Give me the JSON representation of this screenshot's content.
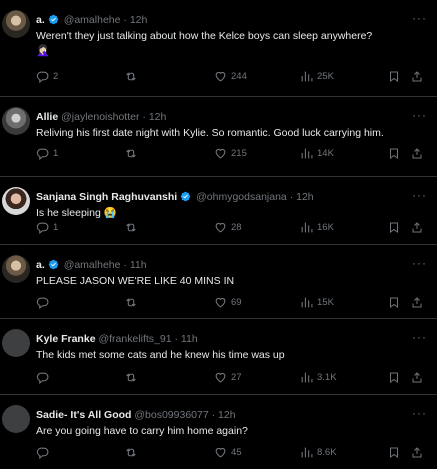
{
  "tweets": [
    {
      "name": "a.",
      "verified": true,
      "handle": "@amalhehe",
      "time": "12h",
      "text": "Weren't they just talking about how the Kelce boys can sleep anywhere?",
      "emoji": "🤦🏻‍♀️",
      "replies": "2",
      "retweets": "",
      "likes": "244",
      "views": "25K"
    },
    {
      "name": "Allie",
      "verified": false,
      "handle": "@jaylenoishotter",
      "time": "12h",
      "text": "Reliving his first date night with Kylie. So romantic. Good luck carrying him.",
      "replies": "1",
      "retweets": "",
      "likes": "215",
      "views": "14K"
    },
    {
      "name": "Sanjana Singh Raghuvanshi",
      "verified": true,
      "handle": "@ohmygodsanjana",
      "time": "12h",
      "text": "Is he sleeping 😭",
      "replies": "1",
      "retweets": "",
      "likes": "28",
      "views": "16K"
    },
    {
      "name": "a.",
      "verified": true,
      "handle": "@amalhehe",
      "time": "11h",
      "text": "PLEASE JASON WE'RE LIKE 40 MINS IN",
      "replies": "",
      "retweets": "",
      "likes": "69",
      "views": "15K"
    },
    {
      "name": "Kyle Franke",
      "verified": false,
      "handle": "@frankelifts_91",
      "time": "11h",
      "text": "The kids met some cats and he knew his time was up",
      "replies": "",
      "retweets": "",
      "likes": "27",
      "views": "3.1K"
    },
    {
      "name": "Sadie- It's All Good",
      "verified": false,
      "handle": "@bos09936077",
      "time": "12h",
      "text": "Are you going have to carry him home again?",
      "replies": "",
      "retweets": "",
      "likes": "45",
      "views": "8.6K"
    }
  ],
  "dot": "·",
  "icons": [
    "verified-badge-icon",
    "reply-icon",
    "retweet-icon",
    "like-icon",
    "views-icon",
    "bookmark-icon",
    "share-icon",
    "more-icon"
  ],
  "colors": {
    "background": "#000000",
    "text": "#e7e9ea",
    "muted": "#71767b",
    "verified": "#1d9bf0",
    "divider": "#2f3336"
  }
}
